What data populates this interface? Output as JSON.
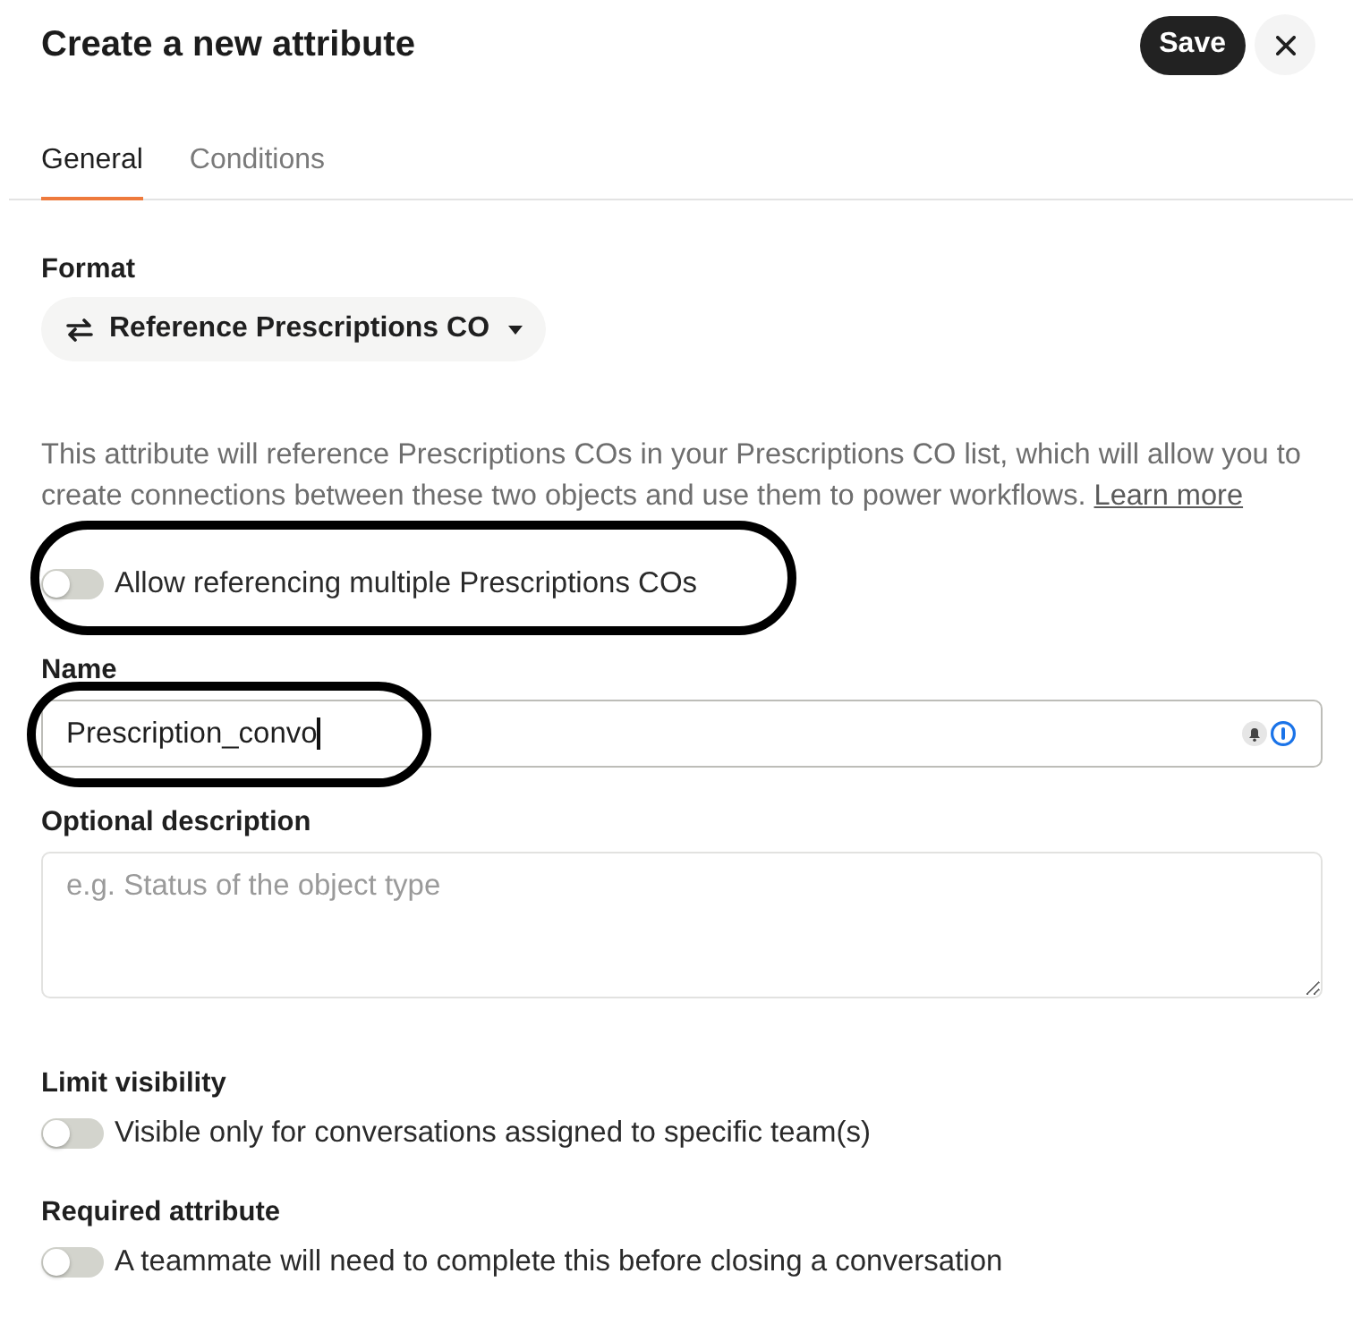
{
  "header": {
    "title": "Create a new attribute",
    "save_button": "Save"
  },
  "tabs": [
    {
      "label": "General",
      "selected": true
    },
    {
      "label": "Conditions",
      "selected": false
    }
  ],
  "format": {
    "label": "Format",
    "value": "Reference Prescriptions CO"
  },
  "info": {
    "text": "This attribute will reference Prescriptions COs in your Prescriptions CO list, which will allow you to create connections between these two objects and use them to power workflows.",
    "link": "Learn more"
  },
  "multiple_toggle": {
    "label": "Allow referencing multiple Prescriptions COs",
    "on": false,
    "circled": true
  },
  "name_field": {
    "label": "Name",
    "value": "Prescription_convo",
    "circled": true
  },
  "description_field": {
    "label": "Optional description",
    "placeholder": "e.g. Status of the object type"
  },
  "settings": [
    {
      "heading": "Limit visibility",
      "label": "Visible only for conversations assigned to specific team(s)",
      "on": false
    },
    {
      "heading": "Required attribute",
      "label": "A teammate will need to complete this before closing a conversation",
      "on": false
    }
  ]
}
